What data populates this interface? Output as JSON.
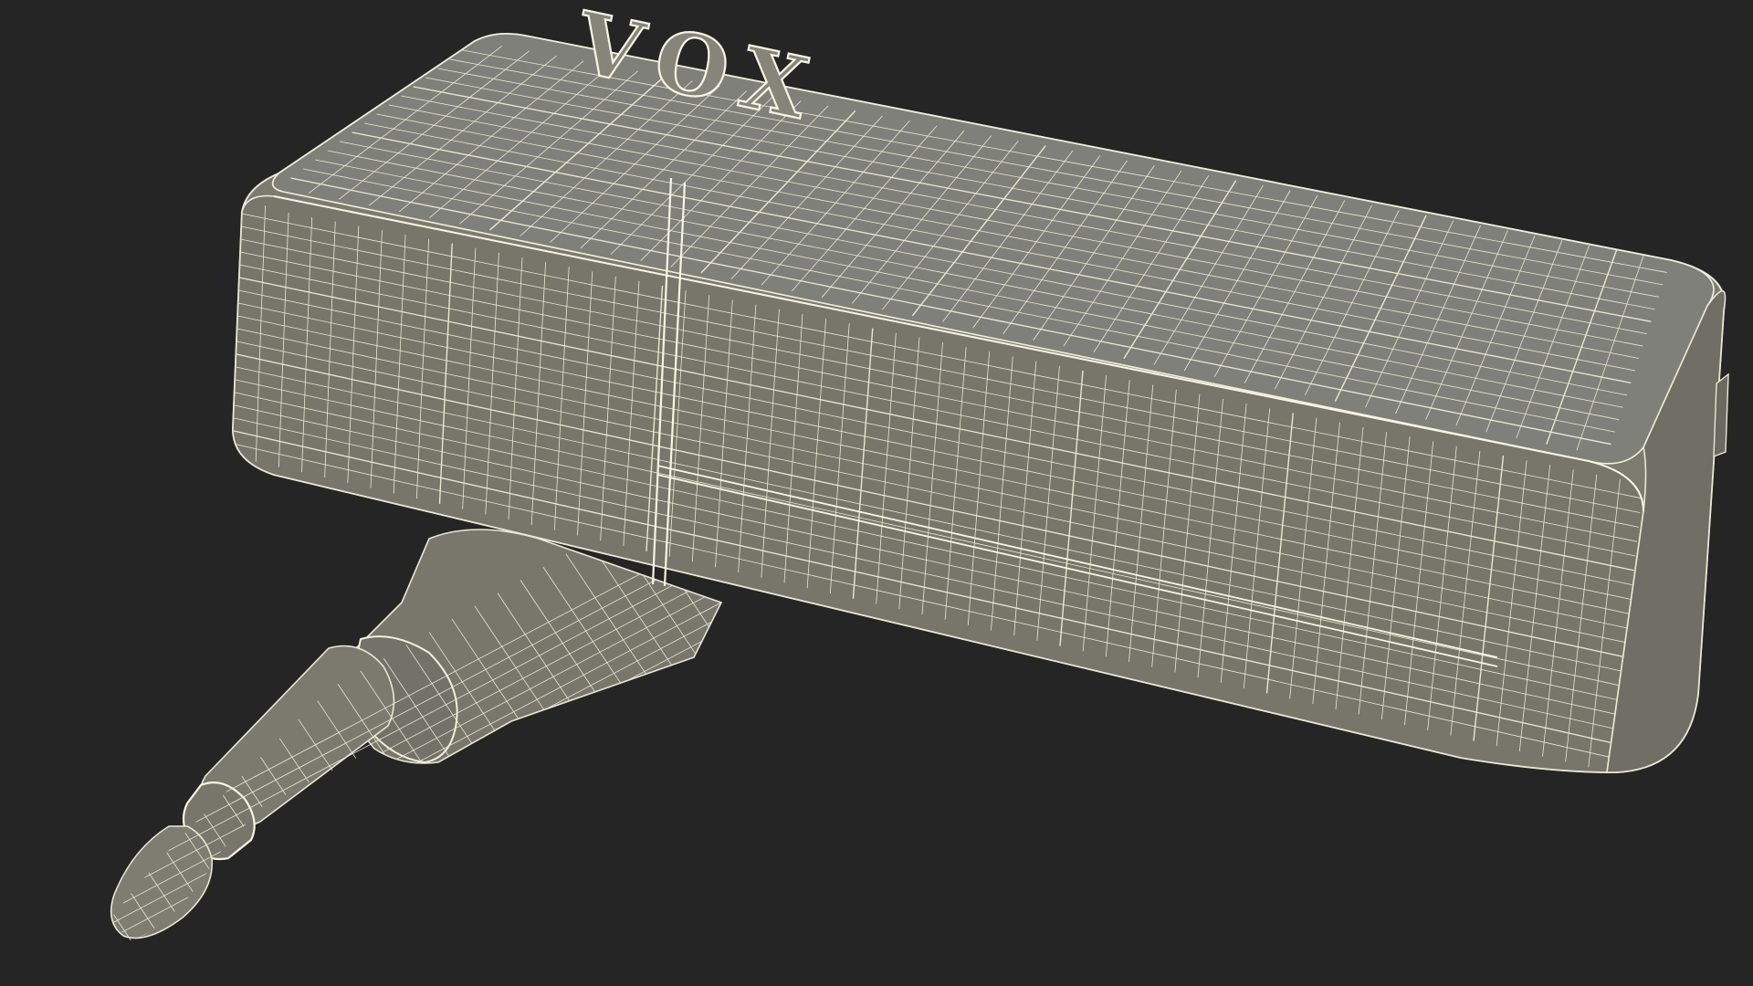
{
  "scene": {
    "subject": "vox-headphone-amp-wireframe",
    "logo": {
      "text": "VOX"
    },
    "colors": {
      "background": "#252525",
      "mesh_fill": "#7b7b70",
      "mesh_fill_dark": "#6b6b61",
      "mesh_fill_light": "#85857a",
      "wire": "#e8e8d4",
      "wire_bright": "#f6f6e4"
    }
  }
}
